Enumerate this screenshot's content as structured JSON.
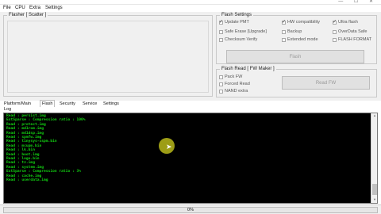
{
  "window": {
    "title": "",
    "controls": "— ☐ ✕"
  },
  "menu": [
    "File",
    "CPU",
    "Extra",
    "Settings"
  ],
  "scatter": {
    "label": "Flasher [ Scatter ]"
  },
  "flash_settings": {
    "label": "Flash Settings",
    "options": [
      {
        "label": "Update PMT",
        "checked": true
      },
      {
        "label": "HW compatibility",
        "checked": true
      },
      {
        "label": "Ultra flash",
        "checked": true
      },
      {
        "label": "Safe Erase [Upgrade]",
        "checked": false
      },
      {
        "label": "Backup",
        "checked": false
      },
      {
        "label": "OverData Safe",
        "checked": false
      },
      {
        "label": "Checksum Verify",
        "checked": false
      },
      {
        "label": "Extended mode",
        "checked": false
      },
      {
        "label": "FLASH FORMAT",
        "checked": false
      }
    ],
    "button": "Flash"
  },
  "flash_read": {
    "label": "Flash Read [ FW Maker ]",
    "options": [
      {
        "label": "Pack FW",
        "checked": false
      },
      {
        "label": "Forced Read",
        "checked": false
      },
      {
        "label": "NAND extra",
        "checked": false
      }
    ],
    "button": "Read FW"
  },
  "tabs": [
    "Platform/Main",
    "Flash",
    "Security",
    "Service",
    "Settings"
  ],
  "active_tab": "Flash",
  "log": {
    "label": "Log",
    "lines": [
      "Read : persist.img",
      "ExtSparse : Compression ratio : 100%",
      "Read : protect.img",
      "Read : md1rom.img",
      "Read : md1dsp.img",
      "Read : spmfw.img",
      "Read : tinysys-sspm.bin",
      "Read : mcupm.bin",
      "Read : lk.bin",
      "Read : boot.img",
      "Read : logo.bin",
      "Read : tz.img",
      "Read : system.img",
      "ExtSparse : Compression ratio : 3%",
      "Read : cache.img",
      "Read : userdata.img"
    ]
  },
  "progress": {
    "value": 0,
    "text": "0%"
  },
  "colors": {
    "console_bg": "#000000",
    "console_text": "#12d412",
    "cursor_highlight": "#d2d21e",
    "progress_fill": "#06b025"
  }
}
